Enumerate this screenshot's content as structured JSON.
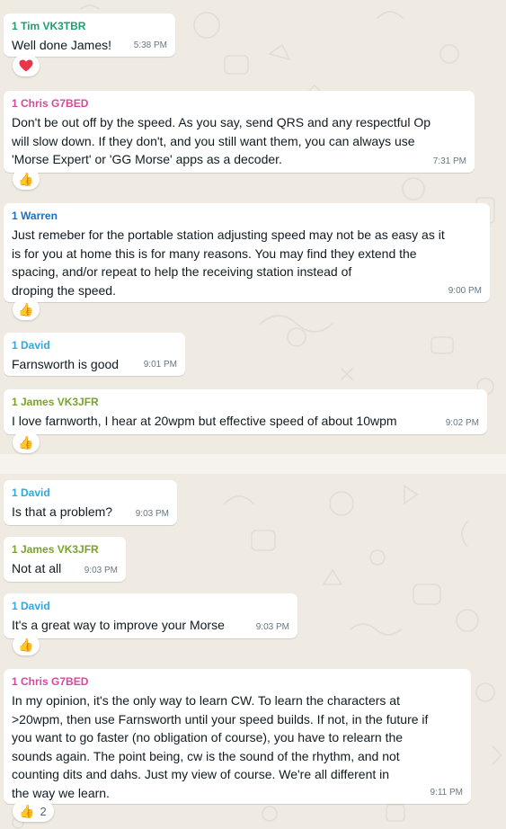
{
  "colors": {
    "background": "#efeae2",
    "bubble": "#ffffff",
    "tim": "#1f9e6e",
    "chris": "#d44a9a",
    "warren": "#1e6fc0",
    "david": "#35a6d8",
    "james": "#7aa22b"
  },
  "messages": [
    {
      "sender": "1 Tim VK3TBR",
      "text": "Well done James!",
      "time": "5:38 PM",
      "reaction": "heart-icon"
    },
    {
      "sender": "1 Chris G7BED",
      "text": "Don't be out off by the speed. As you say, send QRS and any respectful Op\nwill slow down. If they don't, and you still want them, you can always use\n'Morse Expert' or 'GG Morse' apps as a decoder.",
      "time": "7:31 PM",
      "reaction": "thumbs-up-icon"
    },
    {
      "sender": "1 Warren",
      "text": "Just remeber for the portable station adjusting speed may not be as easy as it\nis for you at home this is for many reasons. You may find they extend the\nspacing, and/or repeat to help the receiving station instead of\ndroping the speed.",
      "time": "9:00 PM",
      "reaction": "thumbs-up-icon"
    },
    {
      "sender": "1 David",
      "text": "Farnsworth is good",
      "time": "9:01 PM"
    },
    {
      "sender": "1 James VK3JFR",
      "text": "I love farnworth, I hear at 20wpm but effective speed of about 10wpm",
      "time": "9:02 PM",
      "reaction": "thumbs-up-icon"
    },
    {
      "sender": "1 David",
      "text": "Is that a problem?",
      "time": "9:03 PM"
    },
    {
      "sender": "1 James VK3JFR",
      "text": "Not at all",
      "time": "9:03 PM"
    },
    {
      "sender": "1 David",
      "text": "It's a great way to improve your Morse",
      "time": "9:03 PM",
      "reaction": "thumbs-up-icon"
    },
    {
      "sender": "1 Chris G7BED",
      "text": "In my opinion, it's the only way to learn CW. To learn the characters at\n>20wpm, then use Farnsworth until your speed builds. If not, in the future if\nyou want to go faster (no obligation of course), you have to relearn the\nsounds again. The point being, cw is the sound of the rhythm, and not\ncounting dits and dahs. Just my view of course. We're all different in\nthe way we learn.",
      "time": "9:11 PM",
      "reaction": "thumbs-up-icon",
      "reaction_count": "2"
    }
  ]
}
